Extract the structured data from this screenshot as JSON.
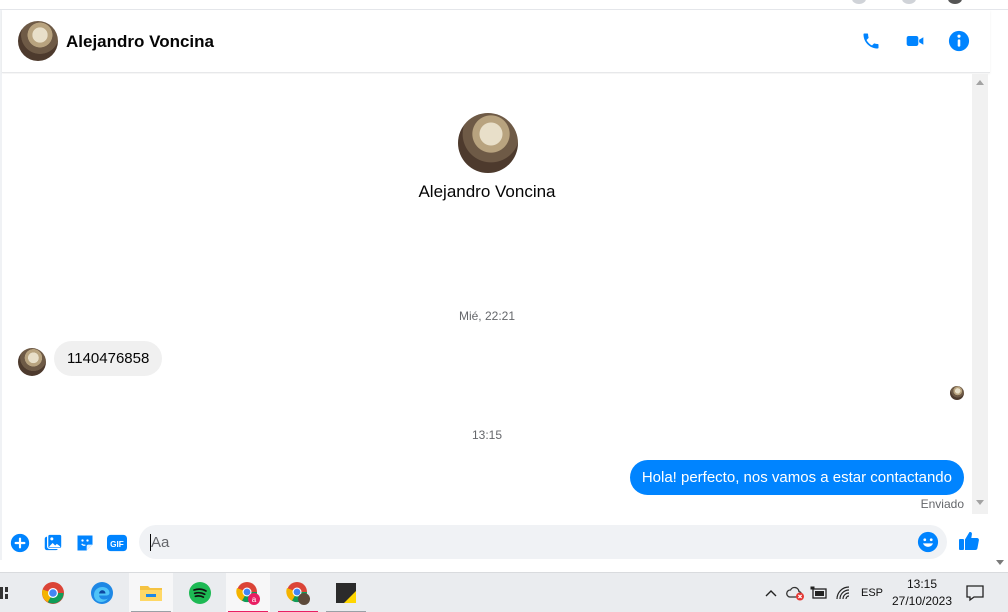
{
  "header": {
    "contact_name": "Alejandro Voncina",
    "call_icon": "phone-icon",
    "video_icon": "video-camera-icon",
    "info_icon": "info-icon"
  },
  "conversation": {
    "profile_name": "Alejandro Voncina",
    "groups": [
      {
        "timestamp": "Mié, 22:21",
        "messages": [
          {
            "direction": "incoming",
            "text": "1140476858"
          }
        ]
      },
      {
        "timestamp": "13:15",
        "messages": [
          {
            "direction": "outgoing",
            "text": "Hola! perfecto, nos vamos a estar contactando",
            "status": "Enviado"
          }
        ]
      }
    ]
  },
  "composer": {
    "placeholder": "Aa",
    "value": "",
    "actions": [
      "plus-icon",
      "image-icon",
      "sticker-icon",
      "gif-icon"
    ],
    "gif_label": "GIF",
    "emoji_icon": "emoji-icon",
    "send_icon": "thumbs-up-icon"
  },
  "taskbar": {
    "apps": [
      "chrome-icon",
      "edge-icon",
      "file-explorer-icon",
      "spotify-icon",
      "chrome-profile-icon",
      "chrome-profile-2-icon",
      "sticky-notes-icon"
    ],
    "tray": {
      "language": "ESP",
      "time": "13:15",
      "date": "27/10/2023"
    }
  },
  "colors": {
    "accent": "#0084ff",
    "incoming_bubble": "#f0f0f0",
    "muted_text": "#65676b"
  }
}
